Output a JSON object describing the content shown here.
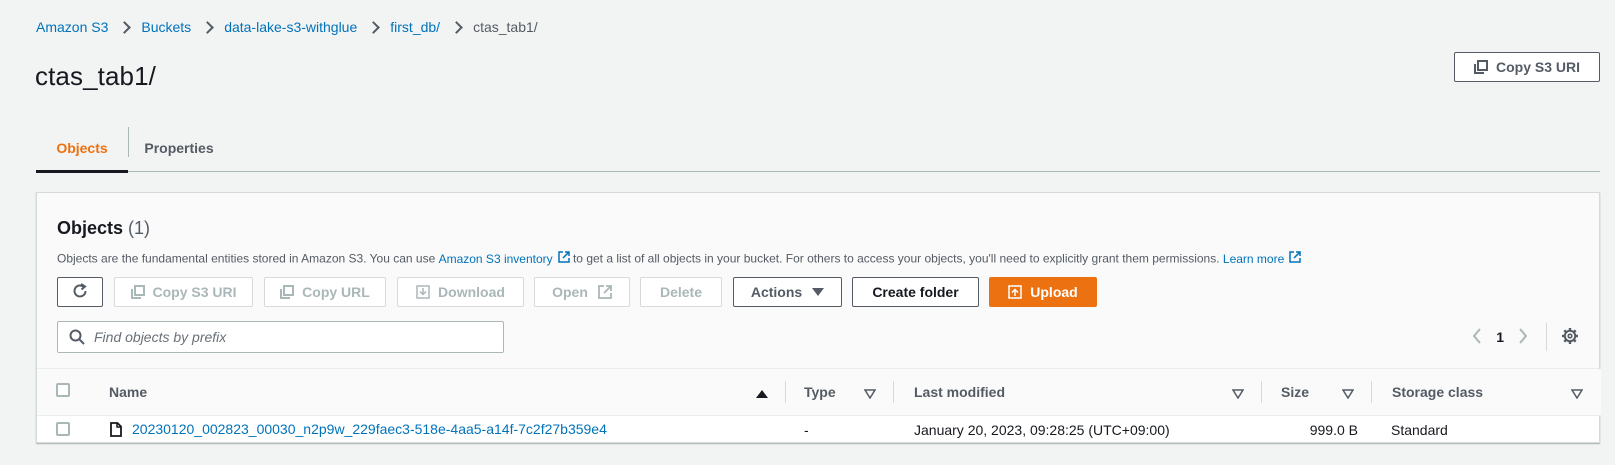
{
  "breadcrumb": [
    {
      "label": "Amazon S3"
    },
    {
      "label": "Buckets"
    },
    {
      "label": "data-lake-s3-withglue"
    },
    {
      "label": "first_db/"
    },
    {
      "label": "ctas_tab1/"
    }
  ],
  "page_title": "ctas_tab1/",
  "header_actions": {
    "copy_s3_uri": "Copy S3 URI"
  },
  "tabs": [
    {
      "label": "Objects",
      "active": true
    },
    {
      "label": "Properties",
      "active": false
    }
  ],
  "objects_panel": {
    "title": "Objects",
    "count": "(1)",
    "description_part1": "Objects are the fundamental entities stored in Amazon S3. You can use ",
    "inventory_link": "Amazon S3 inventory",
    "description_part2": " to get a list of all objects in your bucket. For others to access your objects, you'll need to explicitly grant them permissions. ",
    "learn_more": "Learn more"
  },
  "toolbar": {
    "refresh_icon": "refresh-icon",
    "copy_s3_uri": "Copy S3 URI",
    "copy_url": "Copy URL",
    "download": "Download",
    "open": "Open",
    "delete": "Delete",
    "actions": "Actions",
    "create_folder": "Create folder",
    "upload": "Upload"
  },
  "search": {
    "placeholder": "Find objects by prefix",
    "value": ""
  },
  "pagination": {
    "current_page": "1"
  },
  "table": {
    "columns": [
      "Name",
      "Type",
      "Last modified",
      "Size",
      "Storage class"
    ],
    "rows": [
      {
        "name": "20230120_002823_00030_n2p9w_229faec3-518e-4aa5-a14f-7c2f27b359e4",
        "type": "-",
        "last_modified": "January 20, 2023, 09:28:25 (UTC+09:00)",
        "size": "999.0 B",
        "storage_class": "Standard"
      }
    ]
  },
  "colors": {
    "accent": "#ec7211",
    "link": "#0073bb",
    "text": "#16191f",
    "muted": "#545b64",
    "disabled": "#aab7b8"
  }
}
